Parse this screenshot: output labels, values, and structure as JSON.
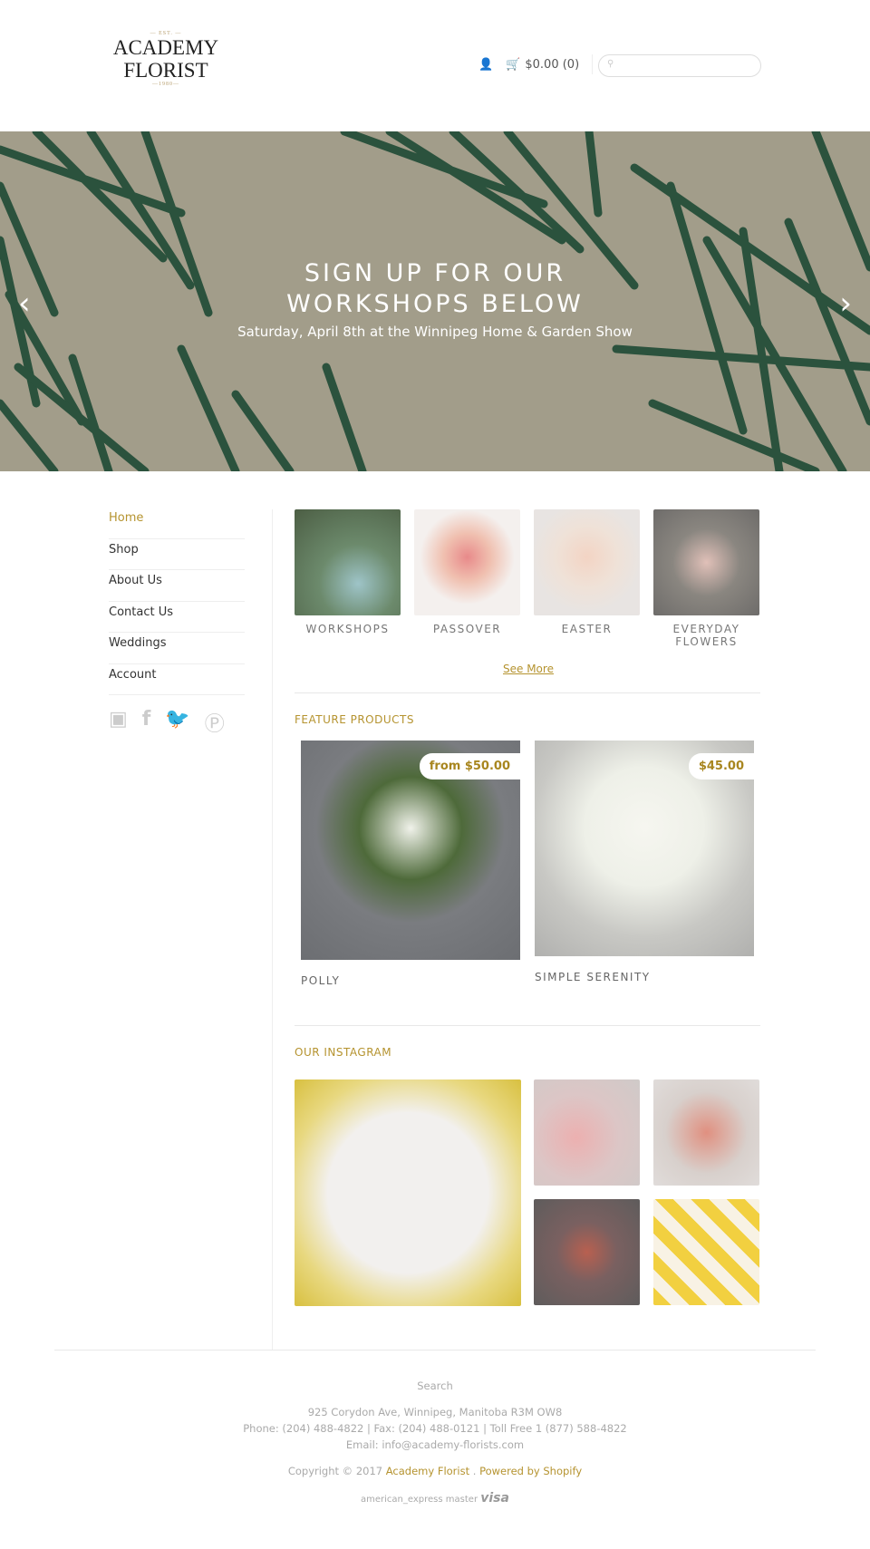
{
  "logo": {
    "est": "— EST. —",
    "line1": "ACADEMY",
    "line2": "FLORIST",
    "year": "—1980—"
  },
  "header": {
    "cart": "$0.00 (0)",
    "search_placeholder": ""
  },
  "hero": {
    "title": "SIGN UP FOR OUR WORKSHOPS BELOW",
    "subtitle": "Saturday, April 8th at the Winnipeg Home & Garden Show"
  },
  "nav": [
    {
      "label": "Home",
      "active": true
    },
    {
      "label": "Shop"
    },
    {
      "label": "About Us"
    },
    {
      "label": "Contact Us"
    },
    {
      "label": "Weddings"
    },
    {
      "label": "Account"
    }
  ],
  "social": [
    "instagram-icon",
    "facebook-icon",
    "twitter-icon",
    "pinterest-icon"
  ],
  "categories": [
    {
      "label": "WORKSHOPS"
    },
    {
      "label": "PASSOVER"
    },
    {
      "label": "EASTER"
    },
    {
      "label": "EVERYDAY FLOWERS"
    }
  ],
  "see_more": "See More",
  "featured": {
    "title": "FEATURE PRODUCTS",
    "products": [
      {
        "name": "POLLY",
        "price": "from $50.00"
      },
      {
        "name": "SIMPLE SERENITY",
        "price": "$45.00"
      }
    ]
  },
  "instagram": {
    "title": "OUR INSTAGRAM"
  },
  "footer": {
    "search": "Search",
    "address": "925 Corydon Ave, Winnipeg, Manitoba R3M OW8",
    "phone": "Phone: (204) 488-4822 | Fax: (204) 488-0121 | Toll Free 1 (877) 588-4822",
    "email": "Email: info@academy-florists.com",
    "copyright": "Copyright © 2017",
    "store": "Academy Florist",
    "sep": ".",
    "powered": "Powered by Shopify",
    "payments": [
      "american_express",
      "master",
      "visa"
    ]
  },
  "colors": {
    "accent": "#b5932f"
  }
}
